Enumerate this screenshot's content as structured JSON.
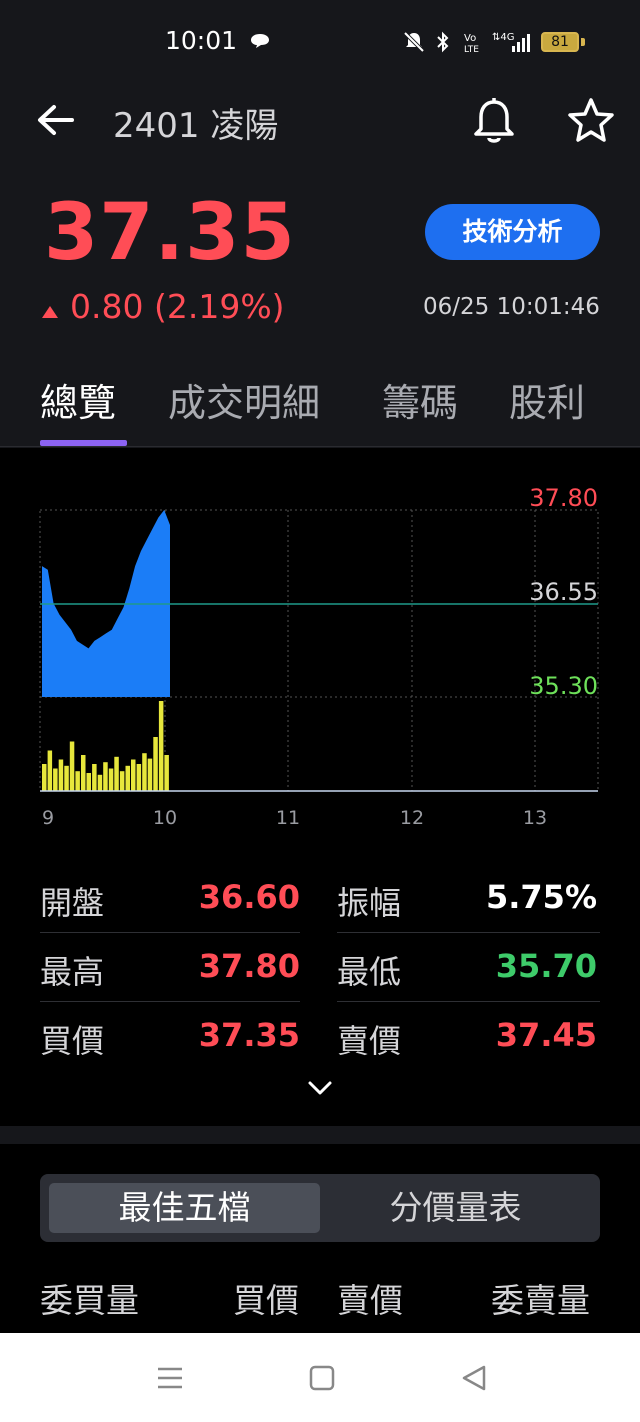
{
  "status_bar": {
    "time": "10:01",
    "battery": "81"
  },
  "header": {
    "title": "2401 凌陽",
    "price": "37.35",
    "change": "0.80 (2.19%)",
    "timestamp": "06/25 10:01:46",
    "tech_button": "技術分析"
  },
  "tabs": [
    "總覽",
    "成交明細",
    "籌碼",
    "股利"
  ],
  "colors": {
    "up": "#ff4d56",
    "down": "#3ecb6a",
    "accent": "#1e6ff0",
    "price_area": "#1b7df7",
    "volume": "#e7e73c"
  },
  "chart_data": {
    "type": "area",
    "y_labels": [
      "37.80",
      "36.55",
      "35.30"
    ],
    "x_labels": [
      "9",
      "10",
      "11",
      "12",
      "13"
    ],
    "price": [
      37.05,
      37.0,
      36.55,
      36.4,
      36.3,
      36.2,
      36.05,
      36.0,
      35.95,
      36.05,
      36.1,
      36.15,
      36.2,
      36.35,
      36.5,
      36.75,
      37.05,
      37.25,
      37.4,
      37.55,
      37.7,
      37.8,
      37.6
    ],
    "volume": [
      0.3,
      0.45,
      0.25,
      0.35,
      0.28,
      0.55,
      0.22,
      0.4,
      0.2,
      0.3,
      0.18,
      0.32,
      0.25,
      0.38,
      0.22,
      0.28,
      0.35,
      0.3,
      0.42,
      0.36,
      0.6,
      1.0,
      0.4
    ]
  },
  "stats": {
    "left": [
      {
        "label": "開盤",
        "value": "36.60",
        "color": "#ff4d56"
      },
      {
        "label": "最高",
        "value": "37.80",
        "color": "#ff4d56"
      },
      {
        "label": "買價",
        "value": "37.35",
        "color": "#ff4d56"
      }
    ],
    "right": [
      {
        "label": "振幅",
        "value": "5.75%",
        "color": "#ffffff"
      },
      {
        "label": "最低",
        "value": "35.70",
        "color": "#3ecb6a"
      },
      {
        "label": "賣價",
        "value": "37.45",
        "color": "#ff4d56"
      }
    ]
  },
  "order_book": {
    "segments": [
      "最佳五檔",
      "分價量表"
    ],
    "columns": [
      "委買量",
      "買價",
      "賣價",
      "委賣量"
    ]
  }
}
